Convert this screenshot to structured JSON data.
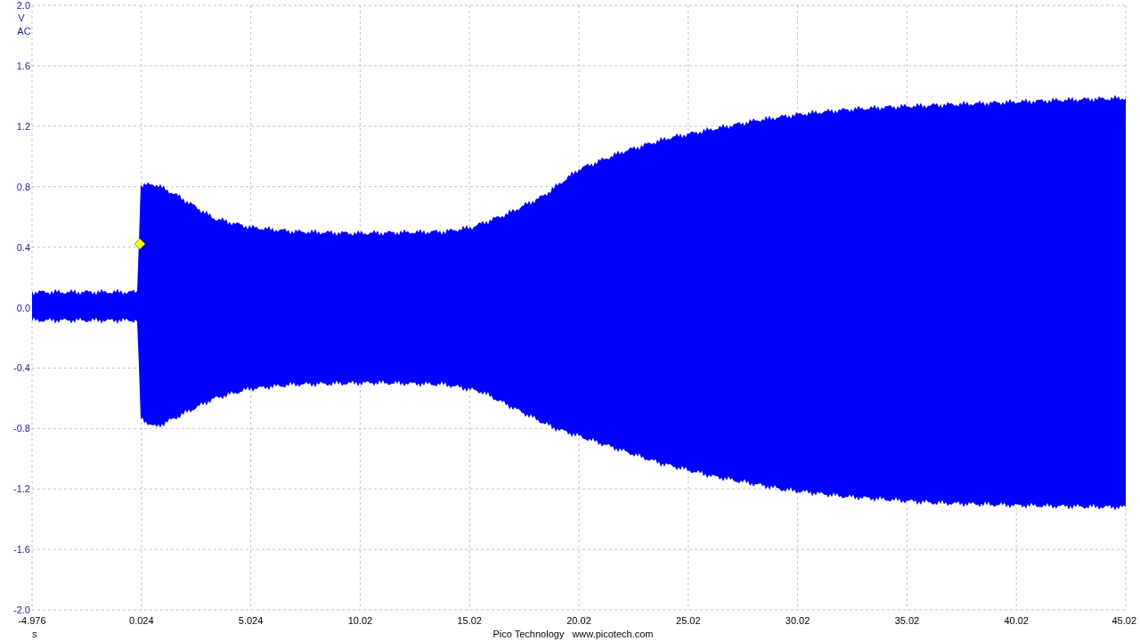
{
  "y_axis": {
    "unit": "V",
    "coupling": "AC",
    "ticks": [
      "2.0",
      "1.6",
      "1.2",
      "0.8",
      "0.4",
      "0.0",
      "-0.4",
      "-0.8",
      "-1.2",
      "-1.6",
      "-2.0"
    ]
  },
  "x_axis": {
    "unit": "s",
    "ticks": [
      "-4.976",
      "0.024",
      "5.024",
      "10.02",
      "15.02",
      "20.02",
      "25.02",
      "30.02",
      "35.02",
      "40.02",
      "45.02"
    ]
  },
  "footer": {
    "company": "Pico Technology",
    "website": "www.picotech.com"
  }
}
